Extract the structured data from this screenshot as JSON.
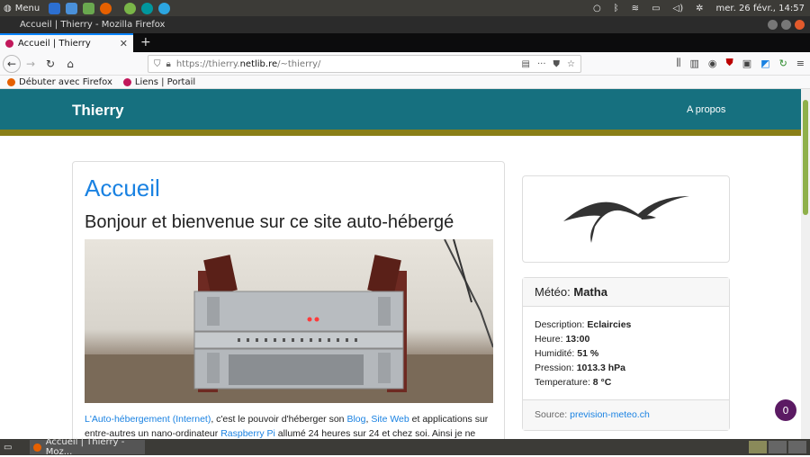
{
  "topbar": {
    "menu_label": "Menu",
    "datetime": "mer. 26 févr., 14:57"
  },
  "window": {
    "title": "Accueil | Thierry - Mozilla Firefox"
  },
  "tabs": [
    {
      "label": "Accueil | Thierry"
    }
  ],
  "address_bar": {
    "url_prefix": "https://thierry.",
    "url_host": "netlib.re",
    "url_path": "/~thierry/"
  },
  "bookmarks": [
    {
      "label": "Débuter avec Firefox"
    },
    {
      "label": "Liens | Portail"
    }
  ],
  "site": {
    "brand": "Thierry",
    "nav_about": "A propos"
  },
  "main": {
    "title": "Accueil",
    "subtitle": "Bonjour et bienvenue sur ce site auto-hébergé",
    "para": {
      "link1": "L'Auto-hébergement (Internet)",
      "t1": ", c'est le pouvoir d'héberger son ",
      "link2": "Blog",
      "t2": ", ",
      "link3": "Site Web",
      "t3": " et applications sur entre-autres un nano-ordinateur ",
      "link4": "Raspberry Pi",
      "t4": " allumé 24 heures sur 24 et chez soi. Ainsi je ne"
    }
  },
  "meteo": {
    "label": "Météo: ",
    "city": "Matha",
    "rows": [
      {
        "k": "Description: ",
        "v": "Eclaircies"
      },
      {
        "k": "Heure: ",
        "v": "13:00"
      },
      {
        "k": "Humidité: ",
        "v": "51 %"
      },
      {
        "k": "Pression: ",
        "v": "1013.3 hPa"
      },
      {
        "k": "Temperature: ",
        "v": "8 °C"
      }
    ],
    "source_label": "Source: ",
    "source_link": "prevision-meteo.ch"
  },
  "badge_count": "0",
  "taskbar": {
    "task_label": "Accueil | Thierry - Moz..."
  },
  "colors": {
    "header": "#16707f",
    "stripe": "#8a7f18",
    "link": "#1a82e2",
    "badge": "#5b1a63"
  }
}
